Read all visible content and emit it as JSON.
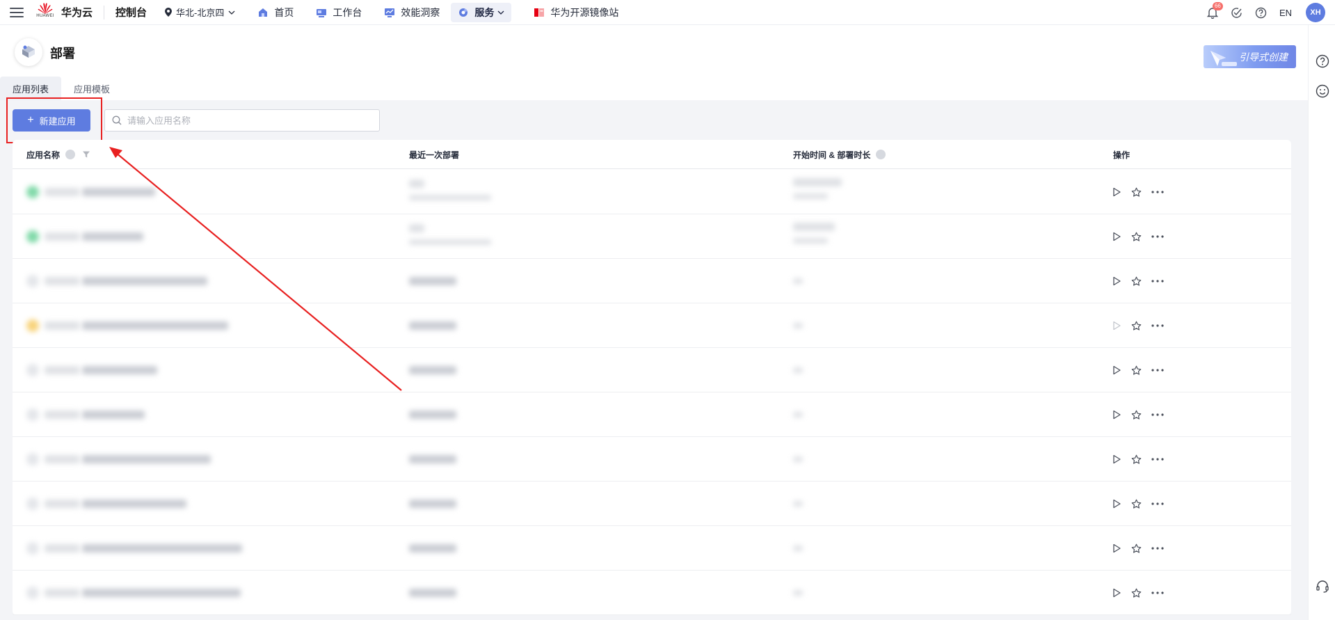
{
  "topbar": {
    "brand": "华为云",
    "logo_word": "HUAWEI",
    "console": "控制台",
    "region": "华北-北京四",
    "nav": [
      {
        "label": "首页",
        "icon": "home-icon"
      },
      {
        "label": "工作台",
        "icon": "workbench-icon"
      },
      {
        "label": "效能洞察",
        "icon": "insight-icon"
      },
      {
        "label": "服务",
        "icon": "service-icon",
        "active": true
      },
      {
        "label": "华为开源镜像站",
        "icon": "mirror-icon"
      }
    ],
    "notification_count": "66",
    "lang": "EN",
    "avatar_initials": "XH"
  },
  "header": {
    "title": "部署",
    "guide_button": "引导式创建"
  },
  "tabs": [
    {
      "label": "应用列表",
      "active": true
    },
    {
      "label": "应用模板",
      "active": false
    }
  ],
  "toolbar": {
    "new_button": "新建应用",
    "search_placeholder": "请输入应用名称"
  },
  "table": {
    "columns": [
      "应用名称",
      "最近一次部署",
      "开始时间 & 部署时长",
      "操作"
    ],
    "row_count": 10
  },
  "colors": {
    "accent": "#5e7ce0",
    "annotation": "#e82020",
    "status_success": "#7fd9a8",
    "status_warning": "#f8d37a"
  }
}
